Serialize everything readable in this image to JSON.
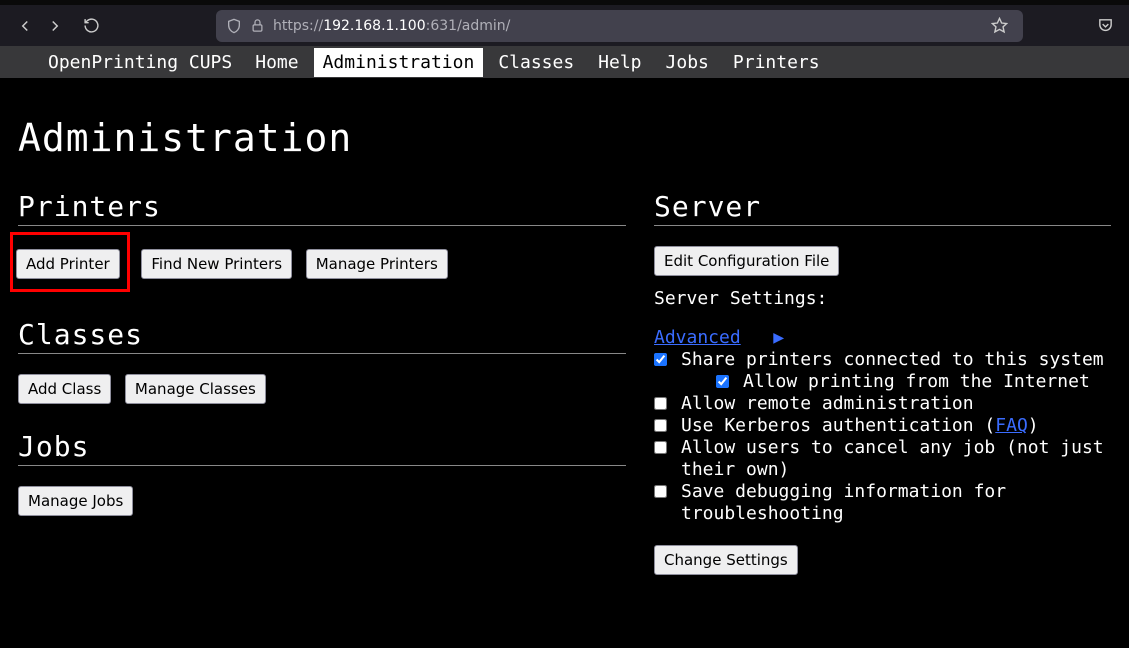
{
  "browser": {
    "url_prefix": "https://",
    "url_host": "192.168.1.100",
    "url_rest": ":631/admin/"
  },
  "nav": {
    "brand": "OpenPrinting CUPS",
    "items": [
      "Home",
      "Administration",
      "Classes",
      "Help",
      "Jobs",
      "Printers"
    ],
    "active_index": 1
  },
  "page_title": "Administration",
  "left": {
    "printers_heading": "Printers",
    "add_printer": "Add Printer",
    "find_new_printers": "Find New Printers",
    "manage_printers": "Manage Printers",
    "classes_heading": "Classes",
    "add_class": "Add Class",
    "manage_classes": "Manage Classes",
    "jobs_heading": "Jobs",
    "manage_jobs": "Manage Jobs"
  },
  "right": {
    "server_heading": "Server",
    "edit_conf": "Edit Configuration File",
    "settings_label": "Server Settings:",
    "advanced": "Advanced",
    "advanced_arrow": "▶",
    "opt_share": "Share printers connected to this system",
    "opt_allow_internet": "Allow printing from the Internet",
    "opt_remote_admin": "Allow remote administration",
    "opt_kerberos_pre": "Use Kerberos authentication (",
    "opt_faq": "FAQ",
    "opt_kerberos_post": ")",
    "opt_cancel_any": "Allow users to cancel any job (not just their own)",
    "opt_debug": "Save debugging information for troubleshooting",
    "change_settings": "Change Settings"
  }
}
